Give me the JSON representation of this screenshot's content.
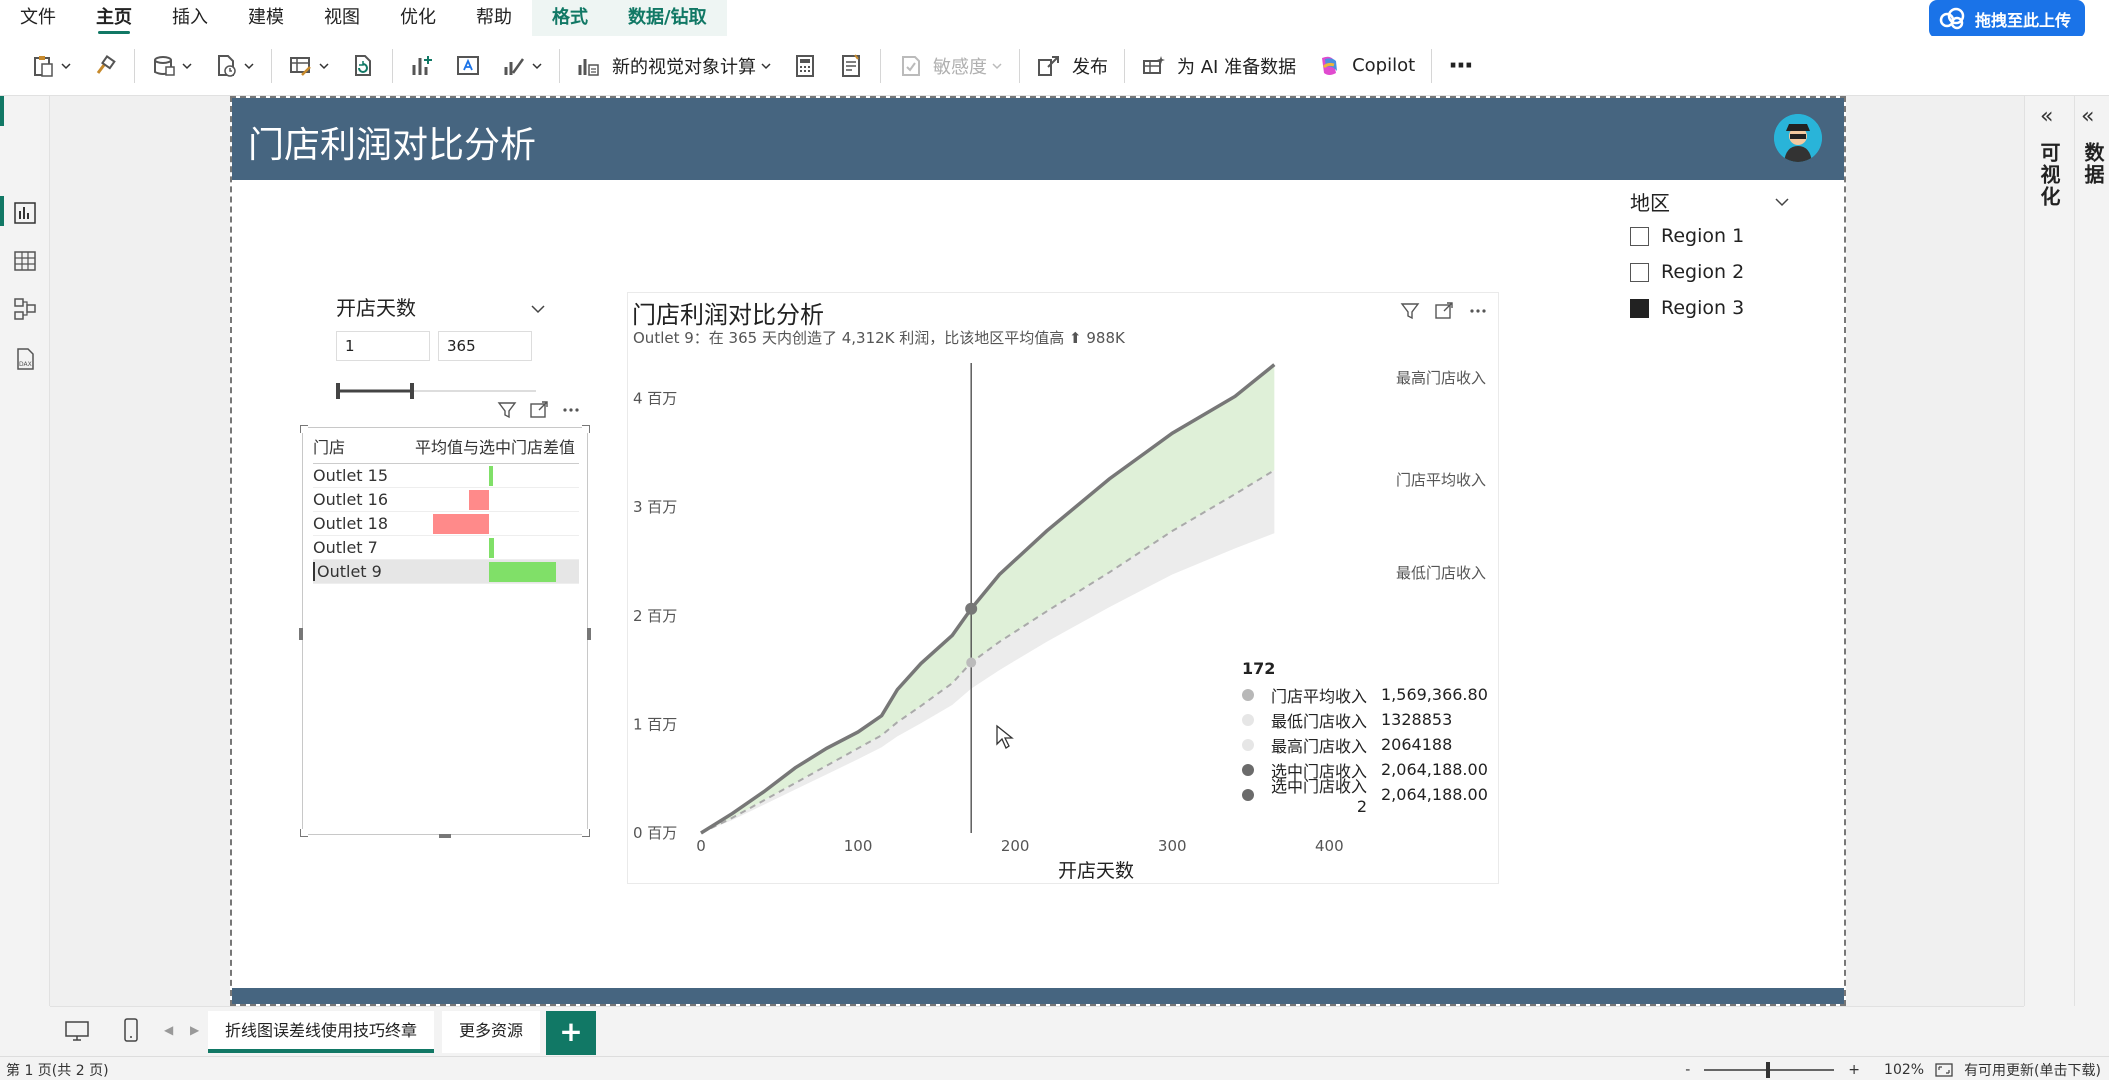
{
  "menu": {
    "items": [
      "文件",
      "主页",
      "插入",
      "建模",
      "视图",
      "优化",
      "帮助"
    ],
    "active_index": 1,
    "context_tabs": [
      "格式",
      "数据/钻取"
    ],
    "upload_label": "拖拽至此上传"
  },
  "ribbon": {
    "new_visual_calc": "新的视觉对象计算",
    "sensitivity": "敏感度",
    "publish": "发布",
    "ai_prep": "为 AI 准备数据",
    "copilot": "Copilot",
    "more": "···"
  },
  "right_panes": {
    "visualizations": "可视化",
    "data": "数据"
  },
  "page": {
    "title": "门店利润对比分析"
  },
  "region_slicer": {
    "title": "地区",
    "items": [
      {
        "label": "Region 1",
        "checked": false
      },
      {
        "label": "Region 2",
        "checked": false
      },
      {
        "label": "Region 3",
        "checked": true
      }
    ]
  },
  "days_slicer": {
    "title": "开店天数",
    "min": "1",
    "max": "365"
  },
  "table": {
    "col_store": "门店",
    "col_diff": "平均值与选中门店差值",
    "rows": [
      {
        "store": "Outlet 15",
        "diff": 0.05
      },
      {
        "store": "Outlet 16",
        "diff": -0.28
      },
      {
        "store": "Outlet 18",
        "diff": -0.8
      },
      {
        "store": "Outlet 7",
        "diff": 0.07
      },
      {
        "store": "Outlet 9",
        "diff": 0.95
      }
    ],
    "selected_index": 4
  },
  "chart": {
    "title": "门店利润对比分析",
    "subtitle": "Outlet 9：在 365 天内创造了 4,312K 利润，比该地区平均值高 ⬆ 988K",
    "xlabel": "开店天数",
    "series_labels": {
      "max": "最高门店收入",
      "avg": "门店平均收入",
      "min": "最低门店收入"
    },
    "x_ticks": [
      "0",
      "100",
      "200",
      "300",
      "400"
    ],
    "y_ticks": [
      "0 百万",
      "1 百万",
      "2 百万",
      "3 百万",
      "4 百万"
    ]
  },
  "chart_data": {
    "type": "area",
    "title": "门店利润对比分析",
    "xlabel": "开店天数",
    "ylabel": "",
    "xlim": [
      0,
      400
    ],
    "ylim": [
      0,
      4500000
    ],
    "x": [
      0,
      20,
      40,
      60,
      80,
      100,
      115,
      125,
      140,
      160,
      172,
      190,
      220,
      260,
      300,
      340,
      365
    ],
    "series": [
      {
        "name": "选中门店收入",
        "values": [
          0,
          180000,
          380000,
          600000,
          780000,
          930000,
          1080000,
          1320000,
          1560000,
          1820000,
          2064188,
          2380000,
          2780000,
          3260000,
          3680000,
          4020000,
          4312000
        ]
      },
      {
        "name": "门店平均收入",
        "values": [
          0,
          140000,
          300000,
          460000,
          620000,
          780000,
          900000,
          1020000,
          1170000,
          1380000,
          1569367,
          1760000,
          2040000,
          2400000,
          2780000,
          3120000,
          3340000
        ]
      },
      {
        "name": "最低门店收入",
        "values": [
          0,
          120000,
          260000,
          400000,
          540000,
          680000,
          790000,
          890000,
          1010000,
          1180000,
          1328853,
          1500000,
          1760000,
          2080000,
          2380000,
          2620000,
          2760000
        ]
      },
      {
        "name": "最高门店收入",
        "values": [
          0,
          180000,
          380000,
          600000,
          780000,
          930000,
          1080000,
          1320000,
          1560000,
          1820000,
          2064188,
          2380000,
          2780000,
          3260000,
          3680000,
          4020000,
          4312000
        ]
      }
    ],
    "cursor_x": 172,
    "grid": false
  },
  "tooltip": {
    "title": "172",
    "rows": [
      {
        "label": "门店平均收入",
        "value": "1,569,366.80",
        "color": "#b8b8b8"
      },
      {
        "label": "最低门店收入",
        "value": "1328853",
        "color": "#e6e6e6"
      },
      {
        "label": "最高门店收入",
        "value": "2064188",
        "color": "#e6e6e6"
      },
      {
        "label": "选中门店收入",
        "value": "2,064,188.00",
        "color": "#6b6b6b"
      },
      {
        "label": "选中门店收入 2",
        "value": "2,064,188.00",
        "color": "#6b6b6b"
      }
    ]
  },
  "tabs": {
    "pages": [
      "折线图误差线使用技巧终章",
      "更多资源"
    ],
    "add": "+"
  },
  "status": {
    "page_info": "第 1 页(共 2 页)",
    "zoom": "102%",
    "update": "有可用更新(单击下载)",
    "minus": "-",
    "plus": "+"
  },
  "colors": {
    "header": "#466580",
    "accent": "#117865",
    "pos_bar": "#80e068",
    "neg_bar": "#ff8a8a",
    "area_fill": "#dff0d8"
  }
}
